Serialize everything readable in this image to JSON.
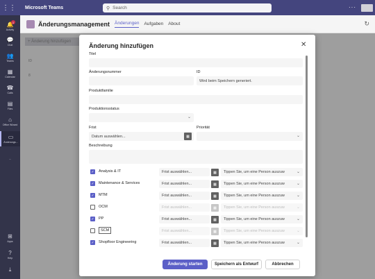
{
  "topbar": {
    "app_title": "Microsoft Teams",
    "search_placeholder": "Search",
    "more": "···"
  },
  "rail": [
    {
      "label": "Activity",
      "icon": "bell-icon",
      "glyph": "🔔",
      "badge": "1"
    },
    {
      "label": "Chat",
      "icon": "chat-icon",
      "glyph": "💬"
    },
    {
      "label": "Teams",
      "icon": "teams-icon",
      "glyph": "👥"
    },
    {
      "label": "Calendar",
      "icon": "calendar-icon",
      "glyph": "▦"
    },
    {
      "label": "Calls",
      "icon": "phone-icon",
      "glyph": "☎"
    },
    {
      "label": "Files",
      "icon": "file-icon",
      "glyph": "▤"
    },
    {
      "label": "Office Wizard",
      "icon": "home-icon",
      "glyph": "⌂"
    },
    {
      "label": "Änderungs...",
      "icon": "app-icon",
      "glyph": "▭"
    },
    {
      "label": "···",
      "icon": "more-icon",
      "glyph": ""
    },
    {
      "label": "Apps",
      "icon": "apps-icon",
      "glyph": "⊞"
    },
    {
      "label": "Help",
      "icon": "help-icon",
      "glyph": "?"
    },
    {
      "label": "",
      "icon": "download-icon",
      "glyph": "⤓"
    }
  ],
  "appheader": {
    "name": "Änderungsmanagement",
    "tabs": [
      "Änderungen",
      "Aufgaben",
      "About"
    ]
  },
  "background": {
    "add_button": "+ Änderung hinzufügen",
    "col_id": "ID",
    "row": "8"
  },
  "dialog": {
    "title": "Änderung hinzufügen",
    "labels": {
      "titel": "Titel",
      "nummer": "Änderungsnummer",
      "id": "ID",
      "produktfamilie": "Produktfamilie",
      "status": "Produktionsstatus",
      "frist": "Frist",
      "prioritaet": "Priorität",
      "beschreibung": "Beschreibung"
    },
    "id_value": "Wird beim Speichern generiert.",
    "date_placeholder": "Datum auswählen..."
  },
  "departments": [
    {
      "name": "Analysis & IT",
      "checked": true,
      "enabled": true
    },
    {
      "name": "Maintenance & Services",
      "checked": true,
      "enabled": true
    },
    {
      "name": "MTM",
      "checked": true,
      "enabled": true
    },
    {
      "name": "OCM",
      "checked": false,
      "enabled": false
    },
    {
      "name": "PP",
      "checked": true,
      "enabled": true
    },
    {
      "name": "SCM",
      "checked": false,
      "enabled": false
    },
    {
      "name": "Shopfloor Engineering",
      "checked": true,
      "enabled": true
    }
  ],
  "dept_frist_placeholder": "Frist auswählen...",
  "dept_person_placeholder": "Tippen Sie, um eine Person auszuw",
  "buttons": {
    "start": "Änderung starten",
    "draft": "Speichern als Entwurf",
    "cancel": "Abbrechen"
  },
  "colors": {
    "brand": "#44457e",
    "accent": "#5b5fc7"
  }
}
